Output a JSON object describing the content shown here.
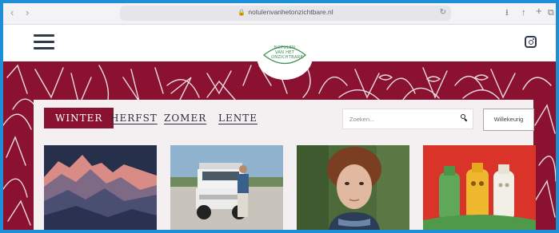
{
  "browser": {
    "url": "notulenvanhetonzichtbare.nl",
    "back_icon": "chevron-left-icon",
    "forward_icon": "chevron-right-icon"
  },
  "site": {
    "logo_text": "NOTULEN VAN HET ONZICHTBARE",
    "accent_color": "#8a1230"
  },
  "tabs": [
    {
      "label": "WINTER",
      "active": true
    },
    {
      "label": "HERFST",
      "active": false
    },
    {
      "label": "ZOMER",
      "active": false
    },
    {
      "label": "LENTE",
      "active": false
    }
  ],
  "search": {
    "placeholder": "Zoeken..."
  },
  "random_button": {
    "label": "Willekeurig"
  },
  "cards": [
    {
      "image": "mountain-illustration"
    },
    {
      "image": "man-with-jeep-photo"
    },
    {
      "image": "portrait-photo"
    },
    {
      "image": "hot-water-bottles-photo"
    }
  ]
}
